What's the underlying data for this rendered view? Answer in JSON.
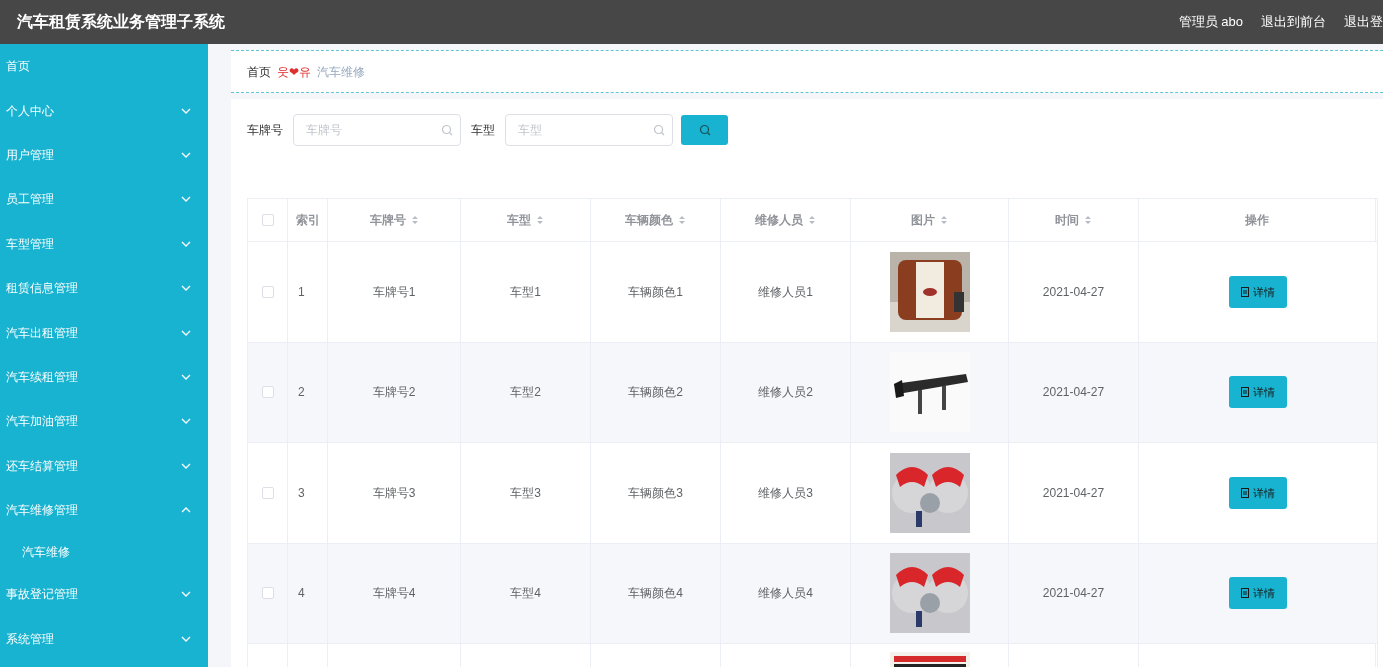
{
  "header": {
    "title": "汽车租赁系统业务管理子系统",
    "links": [
      "管理员 abo",
      "退出到前台",
      "退出登"
    ]
  },
  "sidebar": {
    "items": [
      {
        "label": "首页",
        "kind": "link"
      },
      {
        "label": "个人中心",
        "kind": "menu",
        "expanded": false
      },
      {
        "label": "用户管理",
        "kind": "menu",
        "expanded": false
      },
      {
        "label": "员工管理",
        "kind": "menu",
        "expanded": false
      },
      {
        "label": "车型管理",
        "kind": "menu",
        "expanded": false
      },
      {
        "label": "租赁信息管理",
        "kind": "menu",
        "expanded": false
      },
      {
        "label": "汽车出租管理",
        "kind": "menu",
        "expanded": false
      },
      {
        "label": "汽车续租管理",
        "kind": "menu",
        "expanded": false
      },
      {
        "label": "汽车加油管理",
        "kind": "menu",
        "expanded": false
      },
      {
        "label": "还车结算管理",
        "kind": "menu",
        "expanded": false
      },
      {
        "label": "汽车维修管理",
        "kind": "menu",
        "expanded": true,
        "children": [
          {
            "label": "汽车维修"
          }
        ]
      },
      {
        "label": "事故登记管理",
        "kind": "menu",
        "expanded": false
      },
      {
        "label": "系统管理",
        "kind": "menu",
        "expanded": false
      }
    ]
  },
  "breadcrumb": {
    "home": "首页",
    "separator": "웃❤유",
    "current": "汽车维修"
  },
  "search": {
    "fields": [
      {
        "label": "车牌号",
        "placeholder": "车牌号"
      },
      {
        "label": "车型",
        "placeholder": "车型"
      }
    ]
  },
  "table": {
    "select_all": {
      "checked": false
    },
    "columns": [
      {
        "label": "索引",
        "sortable": false
      },
      {
        "label": "车牌号",
        "sortable": true
      },
      {
        "label": "车型",
        "sortable": true
      },
      {
        "label": "车辆颜色",
        "sortable": true
      },
      {
        "label": "维修人员",
        "sortable": true
      },
      {
        "label": "图片",
        "sortable": true
      },
      {
        "label": "时间",
        "sortable": true
      },
      {
        "label": "操作",
        "sortable": false
      }
    ],
    "rows": [
      {
        "checked": false,
        "index": "1",
        "plate": "车牌号1",
        "model": "车型1",
        "vehicle_color": "车辆颜色1",
        "repairer": "维修人员1",
        "time": "2021-04-27",
        "action": "详情"
      },
      {
        "checked": false,
        "index": "2",
        "plate": "车牌号2",
        "model": "车型2",
        "vehicle_color": "车辆颜色2",
        "repairer": "维修人员2",
        "time": "2021-04-27",
        "action": "详情"
      },
      {
        "checked": false,
        "index": "3",
        "plate": "车牌号3",
        "model": "车型3",
        "vehicle_color": "车辆颜色3",
        "repairer": "维修人员3",
        "time": "2021-04-27",
        "action": "详情"
      },
      {
        "checked": false,
        "index": "4",
        "plate": "车牌号4",
        "model": "车型4",
        "vehicle_color": "车辆颜色4",
        "repairer": "维修人员4",
        "time": "2021-04-27",
        "action": "详情"
      }
    ]
  }
}
